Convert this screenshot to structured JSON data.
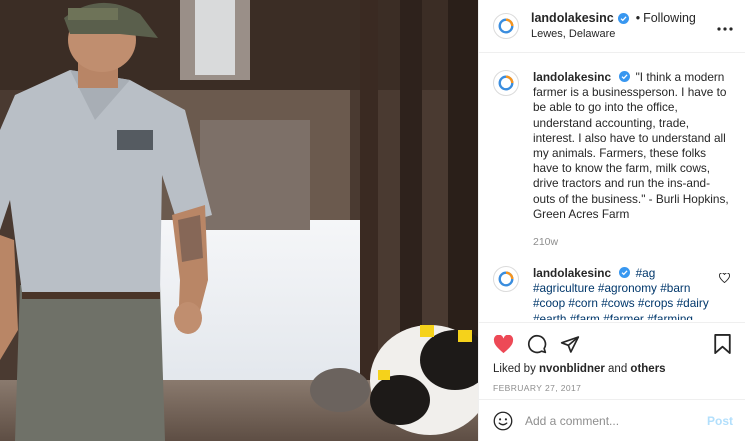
{
  "colors": {
    "brand_orange": "#f7941d",
    "brand_blue": "#3a8dde",
    "verified_blue": "#3897f0",
    "like_red": "#ed4956",
    "hashtag_blue": "#00376b",
    "muted_gray": "#8e8e8e",
    "post_disabled": "#b2dffc"
  },
  "post": {
    "image_alt": "Farmer in grey polo walking in a dairy barn beside cows"
  },
  "header": {
    "username": "landolakesinc",
    "separator": "•",
    "follow_status": "Following",
    "location": "Lewes, Delaware",
    "more_icon": "more-options-icon"
  },
  "caption": {
    "username": "landolakesinc",
    "text": "\"I think a modern farmer is a businessperson. I have to be able to go into the office, understand accounting, trade, interest. I also have to understand all my animals. Farmers, these folks have to know the farm, milk cows, drive tractors and run the ins-and-outs of the business.\" - Burli Hopkins, Green Acres Farm",
    "age": "210w"
  },
  "comment": {
    "username": "landolakesinc",
    "text": "#ag #agriculture #agronomy #barn #coop #corn #cows #crops #dairy #earth #farm #farmer #farming #farmland #feedtheworld #field"
  },
  "actions": {
    "icons": [
      "heart-filled-icon",
      "comment-icon",
      "share-icon",
      "bookmark-icon"
    ],
    "liked_prefix": "Liked by ",
    "liked_user": "nvonblidner",
    "liked_middle": " and ",
    "liked_others": "others",
    "date": "FEBRUARY 27, 2017"
  },
  "add_comment": {
    "placeholder": "Add a comment...",
    "post_label": "Post"
  }
}
